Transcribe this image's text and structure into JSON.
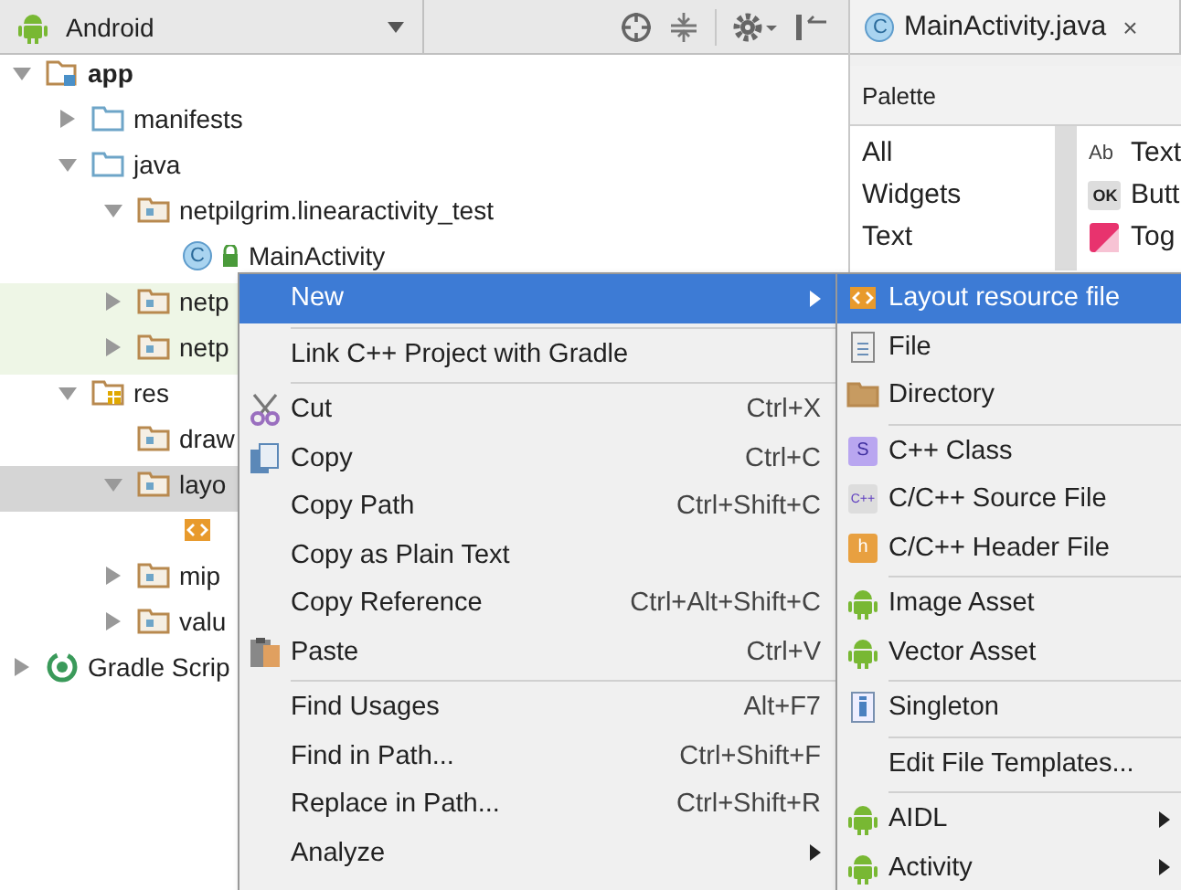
{
  "project_panel": {
    "view_selector": "Android"
  },
  "tree": [
    {
      "label": "app",
      "kind": "module",
      "expanded": true,
      "children": [
        {
          "label": "manifests",
          "kind": "folder",
          "expanded": false
        },
        {
          "label": "java",
          "kind": "folder",
          "expanded": true,
          "children": [
            {
              "label": "netpilgrim.linearactivity_test",
              "kind": "package",
              "expanded": true,
              "children": [
                {
                  "label": "MainActivity",
                  "kind": "class",
                  "icon_text": "C"
                }
              ]
            },
            {
              "label": "netp",
              "kind": "test-package",
              "expanded": false
            },
            {
              "label": "netp",
              "kind": "test-package",
              "expanded": false
            }
          ]
        },
        {
          "label": "res",
          "kind": "res",
          "expanded": true,
          "children": [
            {
              "label": "draw",
              "kind": "package"
            },
            {
              "label": "layo",
              "kind": "package",
              "expanded": true,
              "selected": true,
              "children": [
                {
                  "kind": "layout-file"
                }
              ]
            },
            {
              "label": "mip",
              "kind": "package",
              "expanded": false
            },
            {
              "label": "valu",
              "kind": "package",
              "expanded": false
            }
          ]
        }
      ]
    },
    {
      "label": "Gradle Scrip",
      "kind": "gradle",
      "expanded": false
    }
  ],
  "editor_tab": {
    "icon_text": "C",
    "title": "MainActivity.java",
    "close": "×"
  },
  "palette": {
    "title": "Palette",
    "categories": [
      "All",
      "Widgets",
      "Text"
    ],
    "widgets": [
      {
        "icon_text": "Ab",
        "label": "Text",
        "kind": "text"
      },
      {
        "icon_text": "OK",
        "label": "Butt",
        "kind": "button"
      },
      {
        "label": "Tog",
        "kind": "toggle"
      }
    ]
  },
  "context_menu": [
    {
      "kind": "plain",
      "label": "New",
      "submenu": true,
      "selected": true
    },
    {
      "kind": "separator"
    },
    {
      "kind": "plain",
      "label": "Link C++ Project with Gradle",
      "selected": false
    },
    {
      "kind": "separator"
    },
    {
      "kind": "scissors",
      "label": "Cut",
      "shortcut": "Ctrl+X",
      "selected": false
    },
    {
      "kind": "copy",
      "label": "Copy",
      "shortcut": "Ctrl+C",
      "selected": false
    },
    {
      "kind": "plain",
      "label": "Copy Path",
      "shortcut": "Ctrl+Shift+C",
      "selected": false
    },
    {
      "kind": "plain",
      "label": "Copy as Plain Text",
      "selected": false
    },
    {
      "kind": "plain",
      "label": "Copy Reference",
      "shortcut": "Ctrl+Alt+Shift+C",
      "selected": false
    },
    {
      "kind": "paste",
      "label": "Paste",
      "shortcut": "Ctrl+V",
      "selected": false
    },
    {
      "kind": "separator"
    },
    {
      "kind": "plain",
      "label": "Find Usages",
      "shortcut": "Alt+F7",
      "selected": false
    },
    {
      "kind": "plain",
      "label": "Find in Path...",
      "shortcut": "Ctrl+Shift+F",
      "selected": false
    },
    {
      "kind": "plain",
      "label": "Replace in Path...",
      "shortcut": "Ctrl+Shift+R",
      "selected": false
    },
    {
      "kind": "plain",
      "label": "Analyze",
      "submenu": true,
      "selected": false
    }
  ],
  "new_submenu": [
    {
      "kind": "layout-file",
      "label": "Layout resource file",
      "selected": true
    },
    {
      "kind": "file",
      "label": "File",
      "selected": false
    },
    {
      "kind": "directory",
      "label": "Directory",
      "selected": false
    },
    {
      "kind": "separator"
    },
    {
      "kind": "cpp-class",
      "label": "C++ Class",
      "icon_text": "S",
      "selected": false
    },
    {
      "kind": "cpp-source",
      "label": "C/C++ Source File",
      "icon_text": "C++",
      "selected": false
    },
    {
      "kind": "cpp-header",
      "label": "C/C++ Header File",
      "icon_text": "h",
      "selected": false
    },
    {
      "kind": "separator"
    },
    {
      "kind": "android",
      "label": "Image Asset",
      "selected": false
    },
    {
      "kind": "android",
      "label": "Vector Asset",
      "selected": false
    },
    {
      "kind": "separator"
    },
    {
      "kind": "singleton",
      "label": "Singleton",
      "selected": false
    },
    {
      "kind": "separator"
    },
    {
      "kind": "plain",
      "label": "Edit File Templates...",
      "selected": false
    },
    {
      "kind": "separator"
    },
    {
      "kind": "android",
      "label": "AIDL",
      "submenu": true,
      "selected": false
    },
    {
      "kind": "android",
      "label": "Activity",
      "submenu": true,
      "selected": false
    }
  ]
}
